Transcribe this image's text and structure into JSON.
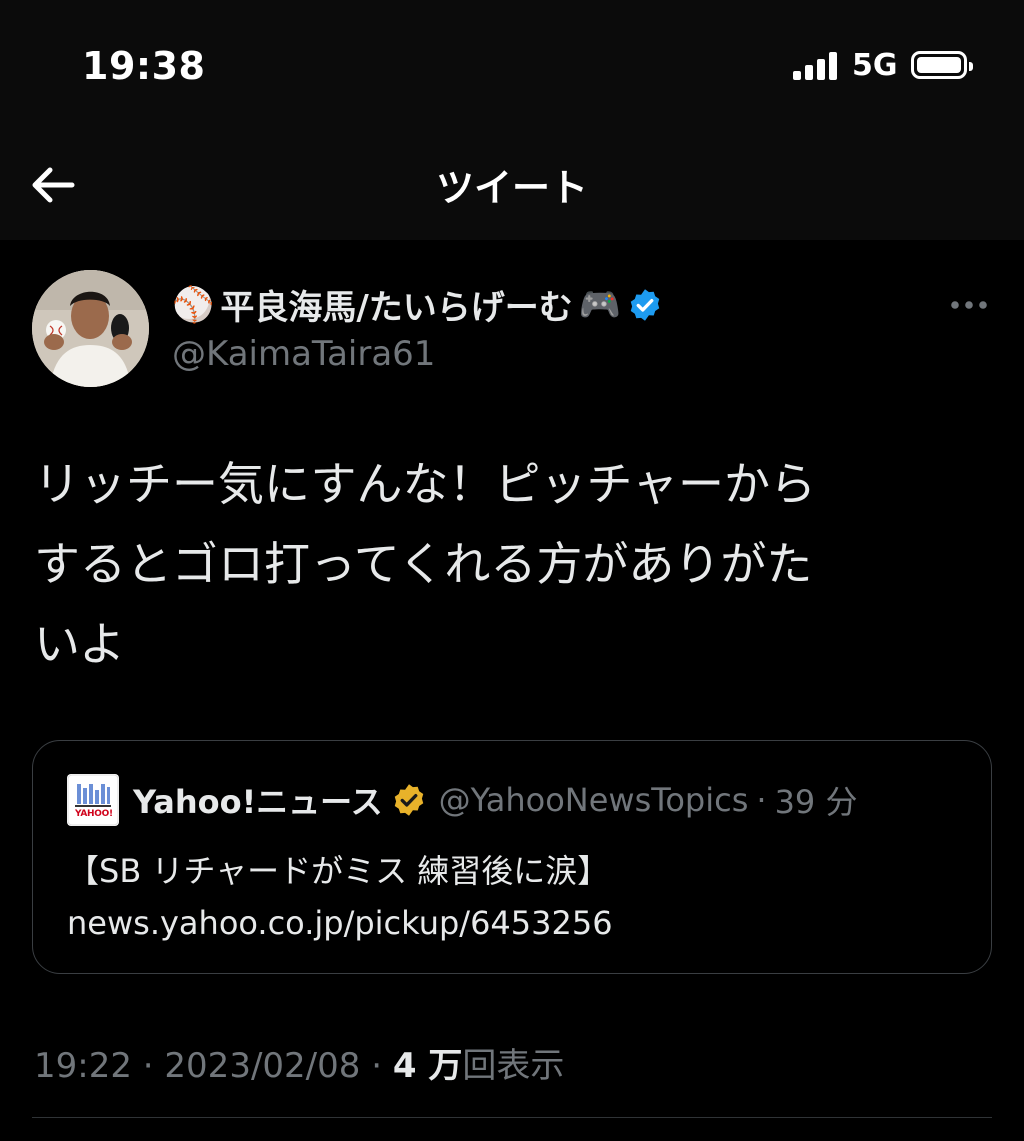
{
  "status_bar": {
    "time": "19:38",
    "network": "5G",
    "signal_bars": 4,
    "battery_level": 1.0
  },
  "header": {
    "title": "ツイート",
    "back_icon": "arrow-left-icon"
  },
  "tweet": {
    "display_name": "平良海馬/たいらげーむ",
    "name_prefix_emoji": "⚾",
    "name_suffix_emoji": "🎮",
    "verified_badge_color": "#1d9bf0",
    "handle": "@KaimaTaira61",
    "text_lines": [
      "リッチー気にすんな！ピッチャーから",
      "するとゴロ打ってくれる方がありがた",
      "いよ"
    ],
    "quote": {
      "name": "Yahoo!ニュース",
      "verified_badge_color": "#e8b22a",
      "handle": "@YahooNewsTopics",
      "separator": "·",
      "time": "39 分",
      "logo_text": "YAHOO!",
      "body_line1": "【SB リチャードがミス 練習後に涙】",
      "body_line2": "news.yahoo.co.jp/pickup/6453256"
    },
    "meta": {
      "time": "19:22",
      "separator": "·",
      "date": "2023/02/08",
      "views_count": "4 万",
      "views_label": "回表示"
    }
  }
}
